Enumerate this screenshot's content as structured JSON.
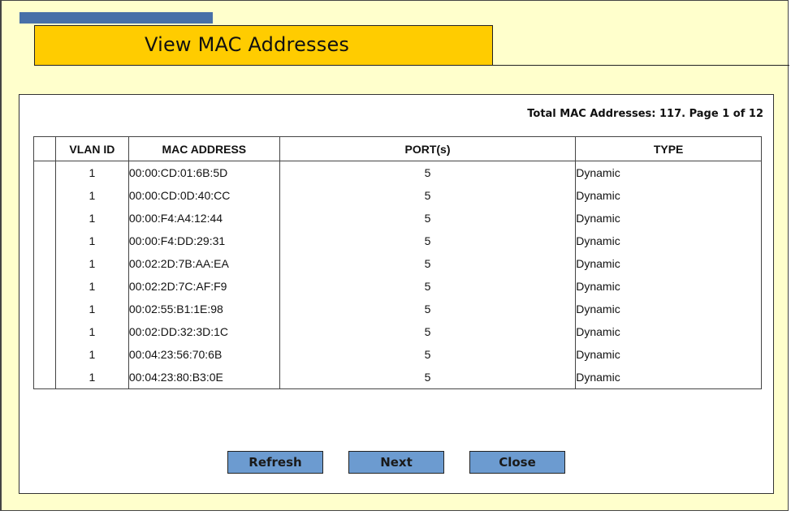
{
  "header": {
    "title": "View MAC Addresses"
  },
  "summary": {
    "total_text": "Total MAC Addresses: 117. Page 1 of 12"
  },
  "table": {
    "columns": [
      "",
      "VLAN ID",
      "MAC ADDRESS",
      "PORT(s)",
      "TYPE"
    ],
    "rows": [
      {
        "vlan": "1",
        "mac": "00:00:CD:01:6B:5D",
        "port": "5",
        "type": "Dynamic"
      },
      {
        "vlan": "1",
        "mac": "00:00:CD:0D:40:CC",
        "port": "5",
        "type": "Dynamic"
      },
      {
        "vlan": "1",
        "mac": "00:00:F4:A4:12:44",
        "port": "5",
        "type": "Dynamic"
      },
      {
        "vlan": "1",
        "mac": "00:00:F4:DD:29:31",
        "port": "5",
        "type": "Dynamic"
      },
      {
        "vlan": "1",
        "mac": "00:02:2D:7B:AA:EA",
        "port": "5",
        "type": "Dynamic"
      },
      {
        "vlan": "1",
        "mac": "00:02:2D:7C:AF:F9",
        "port": "5",
        "type": "Dynamic"
      },
      {
        "vlan": "1",
        "mac": "00:02:55:B1:1E:98",
        "port": "5",
        "type": "Dynamic"
      },
      {
        "vlan": "1",
        "mac": "00:02:DD:32:3D:1C",
        "port": "5",
        "type": "Dynamic"
      },
      {
        "vlan": "1",
        "mac": "00:04:23:56:70:6B",
        "port": "5",
        "type": "Dynamic"
      },
      {
        "vlan": "1",
        "mac": "00:04:23:80:B3:0E",
        "port": "5",
        "type": "Dynamic"
      }
    ]
  },
  "buttons": {
    "refresh": "Refresh",
    "next": "Next",
    "close": "Close"
  },
  "colors": {
    "page_background": "#ffffcc",
    "title_background": "#ffcc00",
    "title_strip": "#4870a8",
    "button_background": "#6c9bd0"
  }
}
